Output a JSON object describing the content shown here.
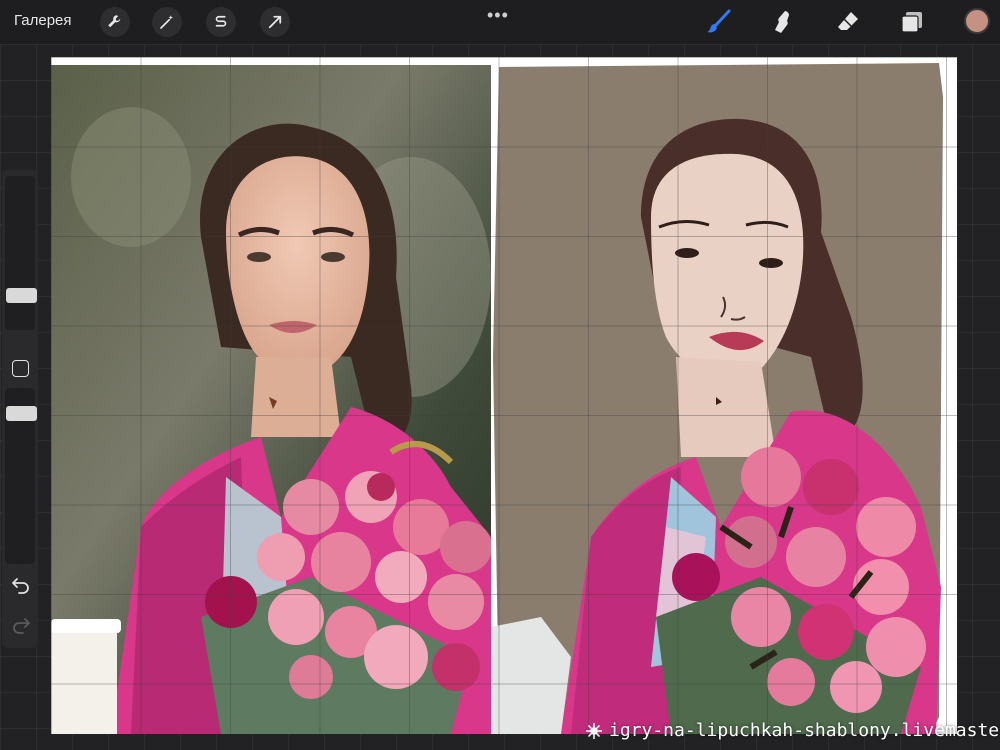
{
  "topbar": {
    "gallery_label": "Галерея",
    "left_tools": [
      "wrench-icon",
      "magic-wand-icon",
      "selection-s-icon",
      "transform-arrow-icon"
    ],
    "right_tools": [
      "brush-icon",
      "smudge-icon",
      "eraser-icon",
      "layers-icon"
    ],
    "active_tool": "brush-icon",
    "current_color": "#c49182"
  },
  "sidebar": {
    "brush_size_level": 0.82,
    "opacity_level": 0.6
  },
  "watermark": {
    "text": "igry-na-lipuchkah-shablony.livemaster.ru"
  },
  "colors": {
    "accent_blue": "#2f7cf6",
    "canvas_bg": "#ffffff",
    "painting_bg": "#8a7d6e",
    "coat_pink": "#d8378a"
  }
}
